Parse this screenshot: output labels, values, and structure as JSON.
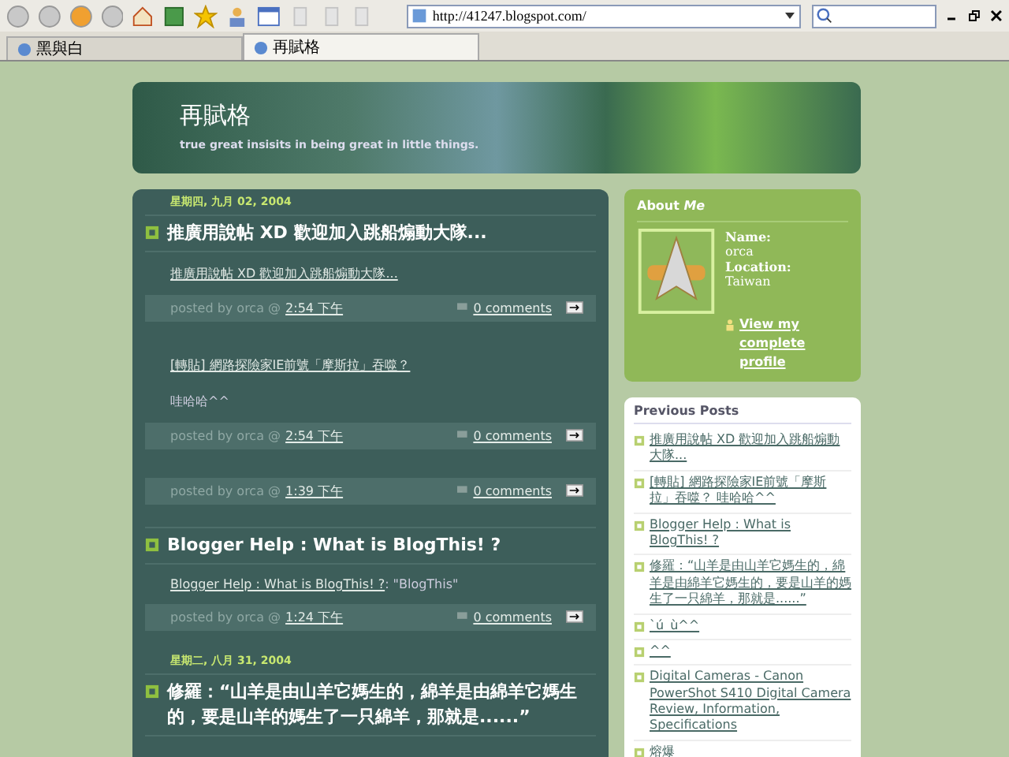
{
  "browser": {
    "address": "http://41247.blogspot.com/",
    "tabs": [
      {
        "label": "黑與白",
        "selected": false
      },
      {
        "label": "再賦格",
        "selected": true
      }
    ]
  },
  "blog": {
    "title": "再賦格",
    "description": "true great insisits in being great in little things."
  },
  "posts": [
    {
      "date": "星期四, 九月 02, 2004",
      "title": "推廣用說帖 XD 歡迎加入跳船煽動大隊...",
      "paragraphs": [
        [
          {
            "link": true,
            "text": "推廣用說帖 XD 歡迎加入跳船煽動大隊..."
          }
        ]
      ],
      "byline": "posted by orca @",
      "time": "2:54 下午",
      "comments": "0 comments"
    },
    {
      "paragraphs": [
        [
          {
            "link": true,
            "text": "[轉貼] 網路探險家IE前號「摩斯拉」吞噬？"
          }
        ],
        [
          {
            "link": false,
            "text": "哇哈哈^^"
          }
        ]
      ],
      "byline": "posted by orca @",
      "time": "2:54 下午",
      "comments": "0 comments"
    },
    {
      "byline": "posted by orca @",
      "time": "1:39 下午",
      "comments": "0 comments"
    },
    {
      "title": "Blogger Help : What is BlogThis! ?",
      "paragraphs": [
        [
          {
            "link": true,
            "text": "Blogger Help : What is BlogThis! ?"
          },
          {
            "link": false,
            "text": ": \"BlogThis\""
          }
        ]
      ],
      "byline": "posted by orca @",
      "time": "1:24 下午",
      "comments": "0 comments"
    },
    {
      "date": "星期二, 八月 31, 2004",
      "title": "修羅：“山羊是由山羊它媽生的，綿羊是由綿羊它媽生的，要是山羊的媽生了一只綿羊，那就是......”"
    }
  ],
  "about": {
    "heading": "About *Me*",
    "fields": [
      "Name:",
      "orca",
      "Location:",
      "Taiwan"
    ],
    "profile_link": "View my complete profile"
  },
  "previous_posts": {
    "heading": "Previous Posts",
    "items": [
      "推廣用說帖 XD 歡迎加入跳船煽動大隊...",
      "[轉貼] 網路探險家IE前號「摩斯拉」吞噬？ 哇哈哈^^",
      "Blogger Help : What is BlogThis! ?",
      "修羅：“山羊是由山羊它媽生的，綿羊是由綿羊它媽生的，要是山羊的媽生了一只綿羊，那就是......”",
      "`ú_ù^^",
      "^^",
      "Digital Cameras - Canon PowerShot S410 Digital Camera Review, Information, Specifications",
      "熔爆"
    ]
  }
}
